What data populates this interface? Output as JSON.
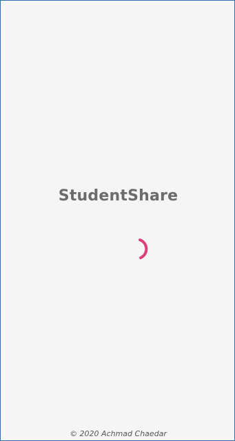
{
  "app": {
    "title": "StudentShare"
  },
  "loading": {
    "spinner_icon": "loading-spinner-icon",
    "accent_color": "#e03e7a"
  },
  "footer": {
    "copyright": "© 2020 Achmad Chaedar"
  },
  "colors": {
    "background": "#f5f5f5",
    "title_text": "#6b6b6b",
    "border": "#2f6fb0"
  }
}
